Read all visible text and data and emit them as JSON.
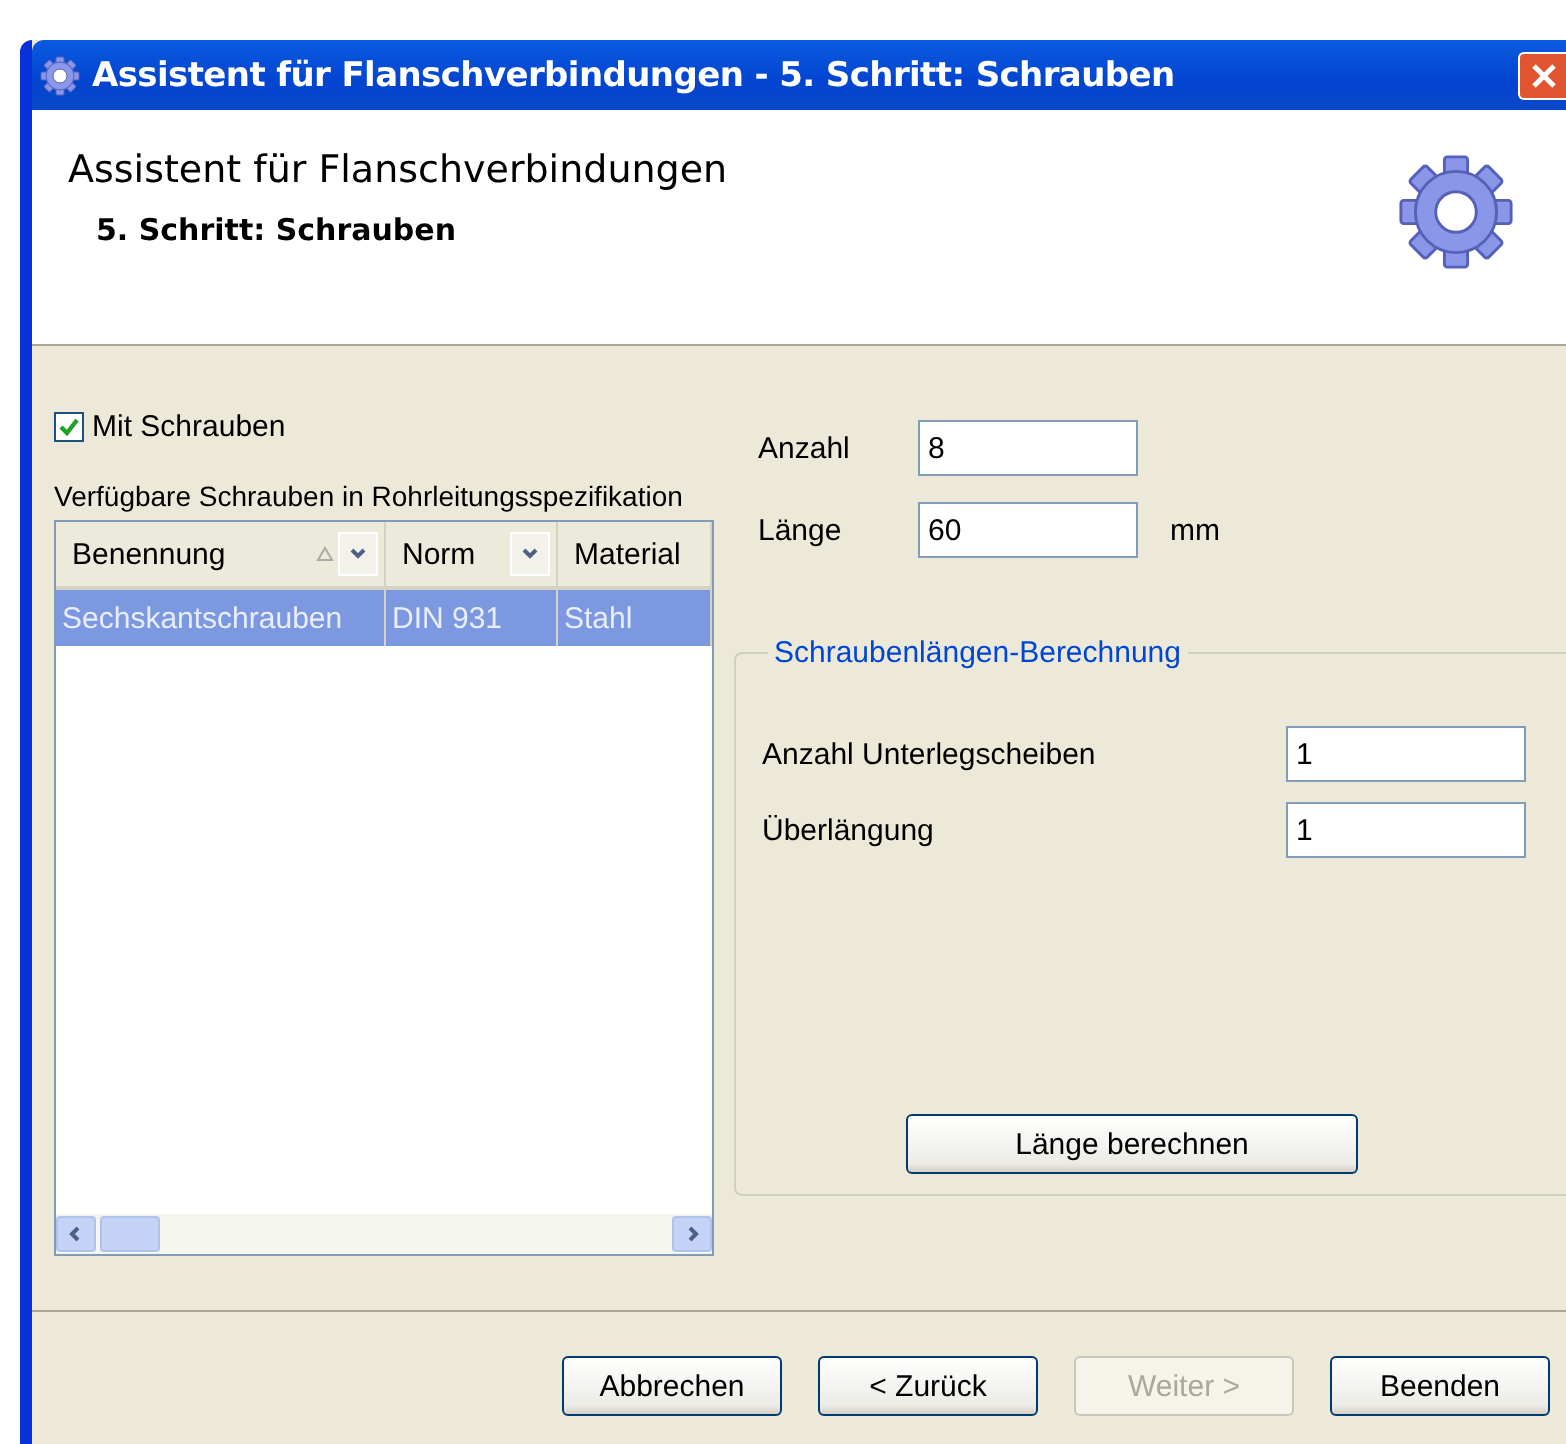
{
  "window": {
    "title": "Assistent für Flanschverbindungen - 5. Schritt: Schrauben"
  },
  "header": {
    "title": "Assistent für Flanschverbindungen",
    "subtitle": "5. Schritt: Schrauben"
  },
  "with_screws": {
    "label": "Mit Schrauben",
    "checked": true
  },
  "table": {
    "caption": "Verfügbare Schrauben in Rohrleitungsspezifikation",
    "columns": [
      {
        "label": "Benennung",
        "sorted": true,
        "filter": true
      },
      {
        "label": "Norm",
        "sorted": false,
        "filter": true
      },
      {
        "label": "Material",
        "sorted": false,
        "filter": false
      }
    ],
    "rows": [
      {
        "cells": [
          "Sechskantschrauben",
          "DIN 931",
          "Stahl"
        ],
        "selected": true
      }
    ]
  },
  "fields": [
    {
      "label": "Anzahl",
      "value": "8"
    },
    {
      "label": "Länge",
      "value": "60",
      "unit": "mm"
    }
  ],
  "calculation": {
    "legend": "Schraubenlängen-Berechnung",
    "fields": [
      {
        "label": "Anzahl Unterlegscheiben",
        "value": "1"
      },
      {
        "label": "Überlängung",
        "value": "1"
      }
    ],
    "button": "Länge berechnen"
  },
  "buttons": [
    {
      "label": "Abbrechen",
      "disabled": false
    },
    {
      "label": "< Zurück",
      "disabled": false
    },
    {
      "label": "Weiter >",
      "disabled": true
    },
    {
      "label": "Beenden",
      "disabled": false
    }
  ]
}
